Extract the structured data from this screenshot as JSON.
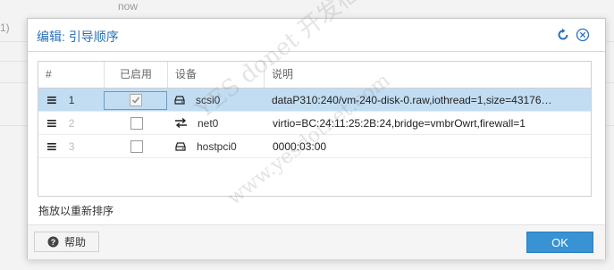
{
  "background": {
    "now_text": "now",
    "left_text": "1)"
  },
  "dialog": {
    "title": "编辑: 引导顺序",
    "grid": {
      "headers": {
        "num": "#",
        "enabled": "已启用",
        "device": "设备",
        "desc": "说明"
      },
      "rows": [
        {
          "order": "1",
          "enabled": true,
          "device": "scsi0",
          "device_icon": "disk-icon",
          "desc": "dataP310:240/vm-240-disk-0.raw,iothread=1,size=43176…",
          "selected": true
        },
        {
          "order": "2",
          "enabled": false,
          "device": "net0",
          "device_icon": "network-icon",
          "desc": "virtio=BC:24:11:25:2B:24,bridge=vmbrOwrt,firewall=1",
          "selected": false
        },
        {
          "order": "3",
          "enabled": false,
          "device": "hostpci0",
          "device_icon": "disk-icon",
          "desc": "0000:03:00",
          "selected": false
        }
      ]
    },
    "hint": "拖放以重新排序",
    "footer": {
      "help_label": "帮助",
      "ok_label": "OK"
    }
  },
  "watermark": {
    "line1": "YES donet 开发框架",
    "line2": "www.yesdotnet.com"
  },
  "colors": {
    "accent": "#2a72b8",
    "ok_button": "#3892d4",
    "selected_row": "#c2ddf2"
  }
}
